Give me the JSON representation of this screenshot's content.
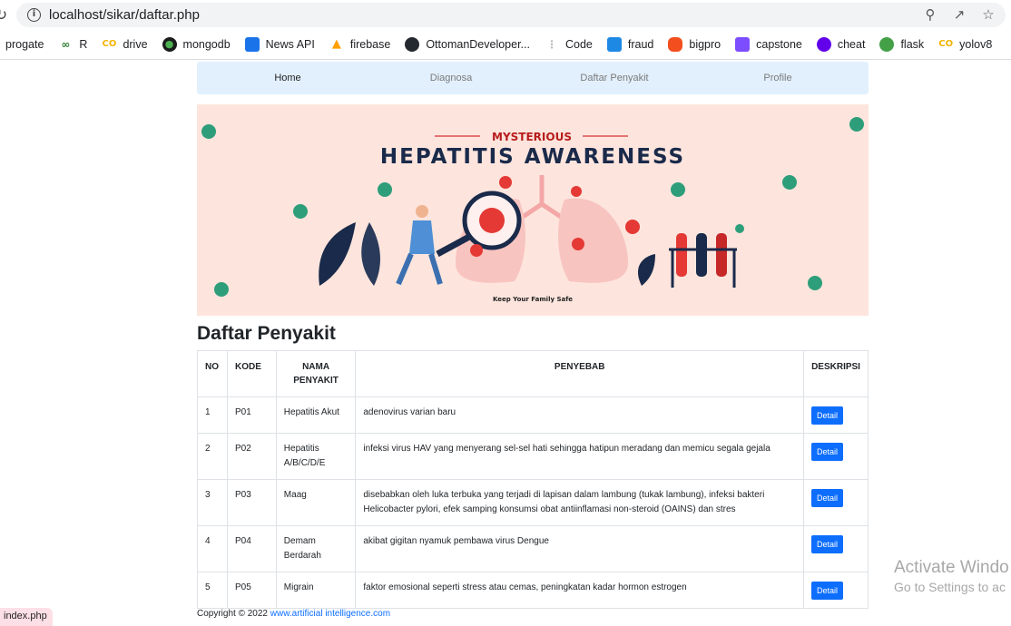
{
  "browser": {
    "url": "localhost/sikar/daftar.php",
    "bookmarks": [
      {
        "label": "progate",
        "color": "#ffffff",
        "icon": "blank-icon"
      },
      {
        "label": "R",
        "color": "#2e7d32",
        "icon": "r-icon"
      },
      {
        "label": "drive",
        "color": "#f4b400",
        "icon": "co-icon"
      },
      {
        "label": "mongodb",
        "color": "#1b1b1b",
        "icon": "leaf-icon"
      },
      {
        "label": "News API",
        "color": "#1a73e8",
        "icon": "news-icon"
      },
      {
        "label": "firebase",
        "color": "#ffa000",
        "icon": "flame-icon"
      },
      {
        "label": "OttomanDeveloper...",
        "color": "#24292f",
        "icon": "github-icon"
      },
      {
        "label": "Code",
        "color": "#cfcfcf",
        "icon": "grid-icon"
      },
      {
        "label": "fraud",
        "color": "#1e88e5",
        "icon": "board-icon"
      },
      {
        "label": "bigpro",
        "color": "#f24e1e",
        "icon": "figma-icon"
      },
      {
        "label": "capstone",
        "color": "#7c4dff",
        "icon": "robot-icon"
      },
      {
        "label": "cheat",
        "color": "#6200ea",
        "icon": "swirl-icon"
      },
      {
        "label": "flask",
        "color": "#43a047",
        "icon": "globe-icon"
      },
      {
        "label": "yolov8",
        "color": "#f4b400",
        "icon": "co-icon"
      }
    ],
    "status_text": "index.php"
  },
  "nav": {
    "home": "Home",
    "diagnosa": "Diagnosa",
    "daftar": "Daftar Penyakit",
    "profile": "Profile"
  },
  "banner": {
    "kicker": "MYSTERIOUS",
    "title": "HEPATITIS AWARENESS",
    "tagline": "Keep Your Family Safe"
  },
  "page": {
    "title": "Daftar Penyakit"
  },
  "table": {
    "headers": {
      "no": "NO",
      "kode": "KODE",
      "nama": "NAMA PENYAKIT",
      "penyebab": "PENYEBAB",
      "deskripsi": "DESKRIPSI"
    },
    "rows": [
      {
        "no": "1",
        "kode": "P01",
        "nama": "Hepatitis Akut",
        "penyebab": "adenovirus varian baru",
        "button": "Detail"
      },
      {
        "no": "2",
        "kode": "P02",
        "nama": "Hepatitis A/B/C/D/E",
        "penyebab": "infeksi virus HAV yang menyerang sel-sel hati sehingga hatipun meradang dan memicu segala gejala",
        "button": "Detail"
      },
      {
        "no": "3",
        "kode": "P03",
        "nama": "Maag",
        "penyebab": "disebabkan oleh luka terbuka yang terjadi di lapisan dalam lambung (tukak lambung), infeksi bakteri Helicobacter pylori, efek samping konsumsi obat antiinflamasi non-steroid (OAINS) dan stres",
        "button": "Detail"
      },
      {
        "no": "4",
        "kode": "P04",
        "nama": "Demam Berdarah",
        "penyebab": "akibat gigitan nyamuk pembawa virus Dengue",
        "button": "Detail"
      },
      {
        "no": "5",
        "kode": "P05",
        "nama": "Migrain",
        "penyebab": "faktor emosional seperti stress atau cemas, peningkatan kadar hormon estrogen",
        "button": "Detail"
      }
    ]
  },
  "footer": {
    "copyright": "Copyright © 2022 ",
    "link": "www.artificial intelligence.com"
  },
  "watermark": {
    "line1": "Activate Windo",
    "line2": "Go to Settings to ac"
  }
}
